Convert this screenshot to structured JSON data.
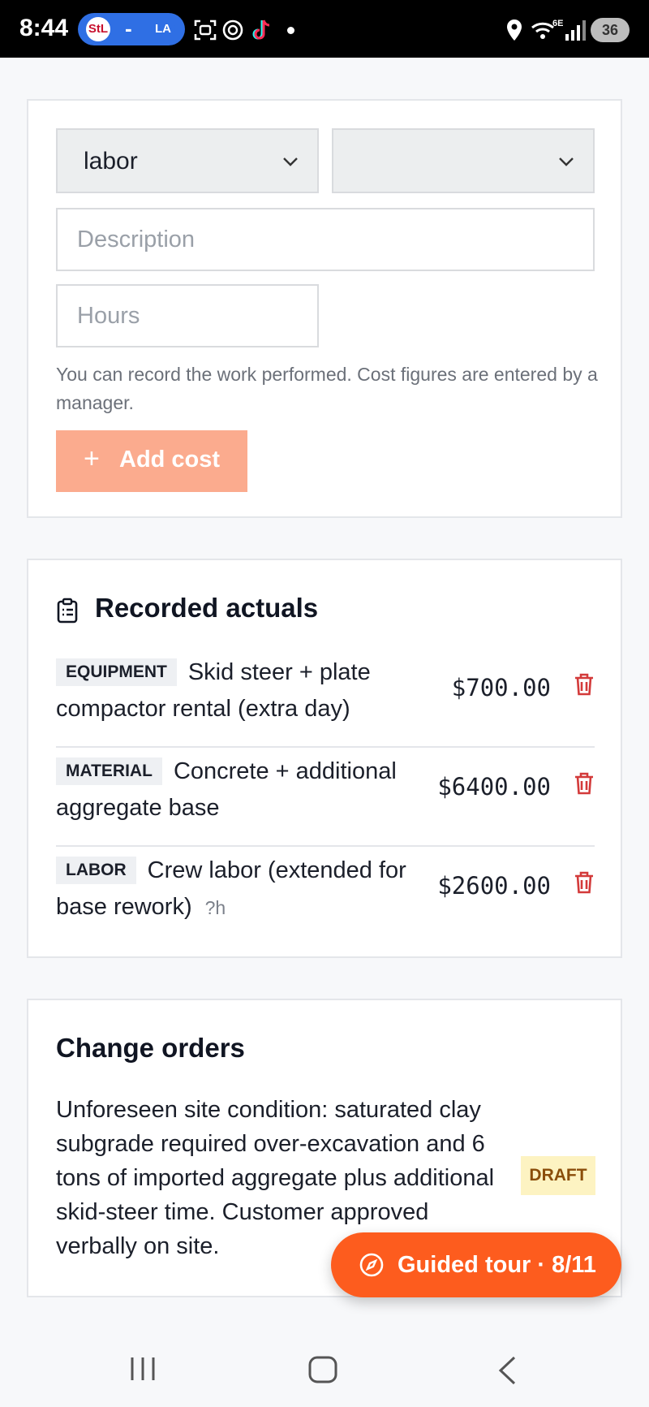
{
  "status_bar": {
    "time": "8:44",
    "pill_dash": "-",
    "icons": [
      "cardinals-logo",
      "dodgers-logo",
      "screenshot-icon",
      "chatgpt-icon",
      "tiktok-icon",
      "notification-dot",
      "location-icon",
      "wifi-6e-icon",
      "signal-icon"
    ],
    "battery": "36"
  },
  "form": {
    "type_select": {
      "value": "labor"
    },
    "secondary_select": {
      "value": ""
    },
    "description": {
      "placeholder": "Description",
      "value": ""
    },
    "hours": {
      "placeholder": "Hours",
      "value": ""
    },
    "help_text": "You can record the work performed. Cost figures are entered by a manager.",
    "add_button": {
      "icon": "+",
      "label": "Add cost"
    }
  },
  "actuals": {
    "title": "Recorded actuals",
    "items": [
      {
        "category": "EQUIPMENT",
        "description": "Skid steer + plate compactor rental (extra day)",
        "hours": "",
        "amount": "$700.00"
      },
      {
        "category": "MATERIAL",
        "description": "Concrete + additional aggregate base",
        "hours": "",
        "amount": "$6400.00"
      },
      {
        "category": "LABOR",
        "description": "Crew labor (extended for base rework)",
        "hours": "?h",
        "amount": "$2600.00"
      }
    ]
  },
  "change_orders": {
    "title": "Change orders",
    "items": [
      {
        "text": "Unforeseen site condition: saturated clay subgrade required over-excavation and 6 tons of imported aggregate plus additional skid-steer time. Customer approved verbally on site.",
        "status": "DRAFT"
      }
    ]
  },
  "tour": {
    "label": "Guided tour · 8/11"
  },
  "colors": {
    "accent": "#fd5c1e",
    "add_button": "#fbab8e",
    "danger": "#d33a3a",
    "draft_bg": "#fdf3c2",
    "draft_text": "#8a4d0a"
  }
}
